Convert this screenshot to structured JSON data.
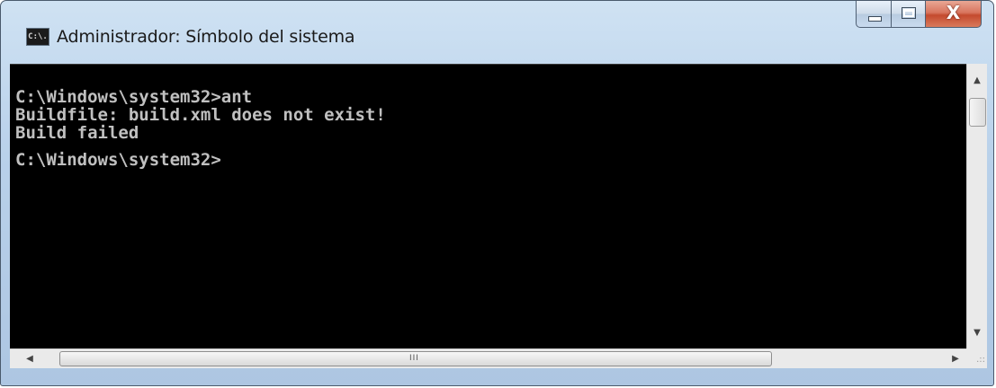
{
  "window": {
    "title": "Administrador: Símbolo del sistema",
    "icon_label": "C:\\.",
    "icon_name": "cmd-icon",
    "close_glyph": "X"
  },
  "console": {
    "lines": [
      "C:\\Windows\\system32>ant",
      "Buildfile: build.xml does not exist!",
      "Build failed",
      "",
      "C:\\Windows\\system32>"
    ]
  },
  "scrollbars": {
    "up_arrow": "▲",
    "down_arrow": "▼",
    "left_arrow": "◀",
    "right_arrow": "▶",
    "h_grip": "III",
    "size_grip": ".::"
  },
  "colors": {
    "console_bg": "#000000",
    "console_fg": "#c0c0c0",
    "close_button": "#c44a2e"
  }
}
